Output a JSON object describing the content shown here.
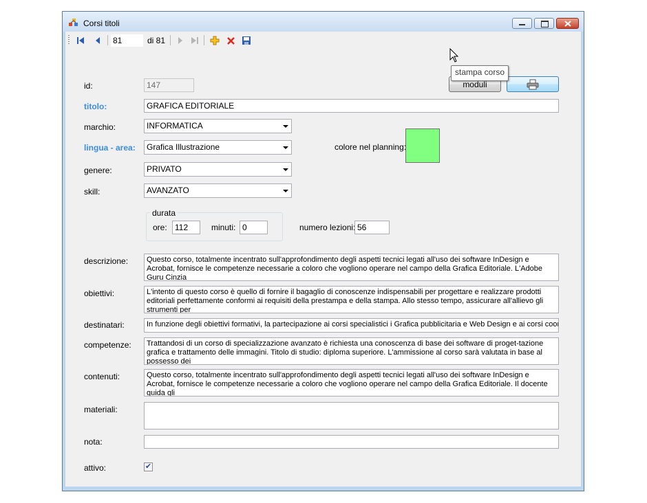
{
  "window": {
    "title": "Corsi titoli"
  },
  "navigator": {
    "position": "81",
    "of_label": "di 81"
  },
  "fields": {
    "id": {
      "label": "id:",
      "value": "147"
    },
    "titolo": {
      "label": "titolo:",
      "value": "GRAFICA EDITORIALE"
    },
    "marchio": {
      "label": "marchio:",
      "value": "INFORMATICA"
    },
    "lingua_area": {
      "label": "lingua - area:",
      "value": "Grafica Illustrazione"
    },
    "genere": {
      "label": "genere:",
      "value": "PRIVATO"
    },
    "skill": {
      "label": "skill:",
      "value": "AVANZATO"
    },
    "colore_planning": {
      "label": "colore nel planning:",
      "color": "#80ff80"
    },
    "durata": {
      "title": "durata",
      "ore_label": "ore:",
      "ore_value": "112",
      "minuti_label": "minuti:",
      "minuti_value": "0"
    },
    "numero_lezioni": {
      "label": "numero lezioni:",
      "value": "56"
    },
    "descrizione": {
      "label": "descrizione:",
      "value": "Questo corso, totalmente incentrato sull'approfondimento degli aspetti tecnici legati all'uso dei software InDesign e Acrobat, fornisce le competenze necessarie a coloro che vogliono operare nel campo della Grafica Editoriale. L'Adobe Guru Cinzia"
    },
    "obiettivi": {
      "label": "obiettivi:",
      "value": "L'intento di questo corso è quello di fornire il bagaglio di conoscenze indispensabili per progettare e realizzare prodotti editoriali perfettamente conformi ai requisiti della prestampa e della stampa. Allo stesso tempo, assicurare all'allievo gli strumenti per"
    },
    "destinatari": {
      "label": "destinatari:",
      "value": "In funzione degli obiettivi formativi, la partecipazione ai corsi specialistici i Grafica pubblicitaria e Web Design e ai corsi coordinat"
    },
    "competenze": {
      "label": "competenze:",
      "value": "Trattandosi di un corso di specializzazione avanzato è richiesta una conoscenza di base dei software di proget-tazione grafica e trattamento delle immagini. Titolo di studio: diploma superiore. L'ammissione al corso sarà valutata in base al possesso dei"
    },
    "contenuti": {
      "label": "contenuti:",
      "value": "Questo corso, totalmente incentrato sull'approfondimento degli aspetti tecnici legati all'uso dei software InDesign e Acrobat, fornisce le competenze necessarie a coloro che vogliono operare nel campo della Grafica Editoriale. Il docente guida gli"
    },
    "materiali": {
      "label": "materiali:",
      "value": ""
    },
    "nota": {
      "label": "nota:",
      "value": ""
    },
    "attivo": {
      "label": "attivo:",
      "checked": true
    }
  },
  "buttons": {
    "moduli": "moduli"
  },
  "tooltip": {
    "text": "stampa corso"
  }
}
